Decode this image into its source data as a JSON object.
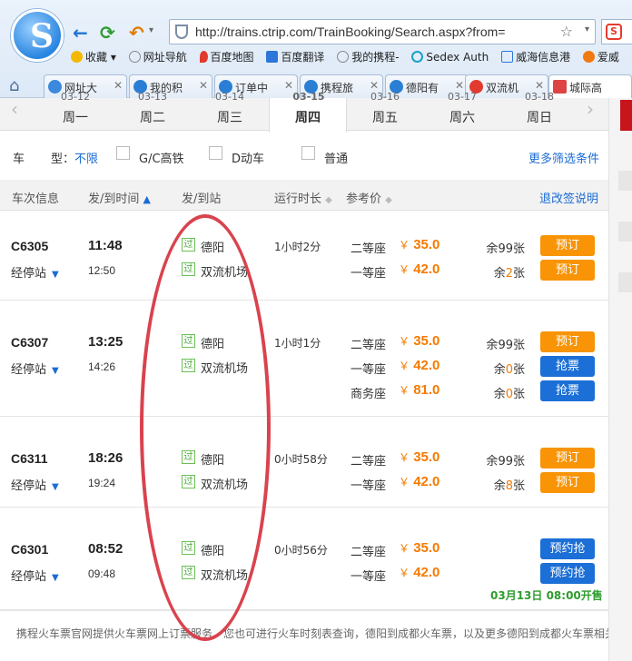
{
  "browser": {
    "url": "http://trains.ctrip.com/TrainBooking/Search.aspx?from=",
    "bookmarks": [
      "收藏",
      "网址导航",
      "百度地图",
      "百度翻译",
      "我的携程-",
      "Sedex Auth",
      "威海信息港",
      "爱威"
    ],
    "tabs": [
      "网址大",
      "我的积",
      "订单中",
      "携程旅",
      "德阳有",
      "双流机",
      "城际高"
    ]
  },
  "dates": {
    "days": [
      {
        "label": "周一",
        "date": "03-12"
      },
      {
        "label": "周二",
        "date": "03-13"
      },
      {
        "label": "周三",
        "date": "03-14"
      },
      {
        "label": "周四",
        "date": "03-15",
        "active": true
      },
      {
        "label": "周五",
        "date": "03-16"
      },
      {
        "label": "周六",
        "date": "03-17"
      },
      {
        "label": "周日",
        "date": "03-18"
      }
    ]
  },
  "filter": {
    "label_a": "车",
    "label_b": "型：",
    "any": "不限",
    "opt_gc": "G/C高铁",
    "opt_d": "D动车",
    "opt_normal": "普通",
    "more": "更多筛选条件"
  },
  "table_header": {
    "train": "车次信息",
    "time": "发/到时间",
    "station": "发/到站",
    "duration": "运行时长",
    "price": "参考价",
    "refund": "退改签说明"
  },
  "labels": {
    "stops": "经停站",
    "pass": "过",
    "book": "预订",
    "grab": "抢票",
    "reserve_grab": "预约抢",
    "yen": "￥"
  },
  "trains": [
    {
      "no": "C6305",
      "dep": "11:48",
      "arr": "12:50",
      "from": "德阳",
      "to": "双流机场",
      "duration": "1小时2分",
      "seats": [
        {
          "class": "二等座",
          "price": "35.0",
          "rem_prefix": "余",
          "rem_num": "99",
          "rem_suffix": "张",
          "btn": "预订"
        },
        {
          "class": "一等座",
          "price": "42.0",
          "rem_prefix": "余",
          "rem_num": "2",
          "rem_suffix": "张",
          "btn": "预订"
        }
      ]
    },
    {
      "no": "C6307",
      "dep": "13:25",
      "arr": "14:26",
      "from": "德阳",
      "to": "双流机场",
      "duration": "1小时1分",
      "seats": [
        {
          "class": "二等座",
          "price": "35.0",
          "rem_prefix": "余",
          "rem_num": "99",
          "rem_suffix": "张",
          "btn": "预订"
        },
        {
          "class": "一等座",
          "price": "42.0",
          "rem_prefix": "余",
          "rem_num": "0",
          "rem_suffix": "张",
          "btn": "抢票"
        },
        {
          "class": "商务座",
          "price": "81.0",
          "rem_prefix": "余",
          "rem_num": "0",
          "rem_suffix": "张",
          "btn": "抢票"
        }
      ]
    },
    {
      "no": "C6311",
      "dep": "18:26",
      "arr": "19:24",
      "from": "德阳",
      "to": "双流机场",
      "duration": "0小时58分",
      "seats": [
        {
          "class": "二等座",
          "price": "35.0",
          "rem_prefix": "余",
          "rem_num": "99",
          "rem_suffix": "张",
          "btn": "预订"
        },
        {
          "class": "一等座",
          "price": "42.0",
          "rem_prefix": "余",
          "rem_num": "8",
          "rem_suffix": "张",
          "btn": "预订"
        }
      ]
    },
    {
      "no": "C6301",
      "dep": "08:52",
      "arr": "09:48",
      "from": "德阳",
      "to": "双流机场",
      "duration": "0小时56分",
      "seats": [
        {
          "class": "二等座",
          "price": "35.0",
          "btn": "预约抢"
        },
        {
          "class": "一等座",
          "price": "42.0",
          "btn": "预约抢"
        }
      ],
      "open_sale": "03月13日 08:00开售"
    }
  ],
  "footer": "携程火车票官网提供火车票网上订票服务，您也可进行火车时刻表查询，德阳到成都火车票，以及更多德阳到成都火车票相关信息",
  "colors": {
    "accent": "#1c6cd4",
    "price": "#f57a00",
    "book_btn": "#f89406",
    "grab_btn": "#1b6fd6",
    "annotation": "#d9434e"
  }
}
